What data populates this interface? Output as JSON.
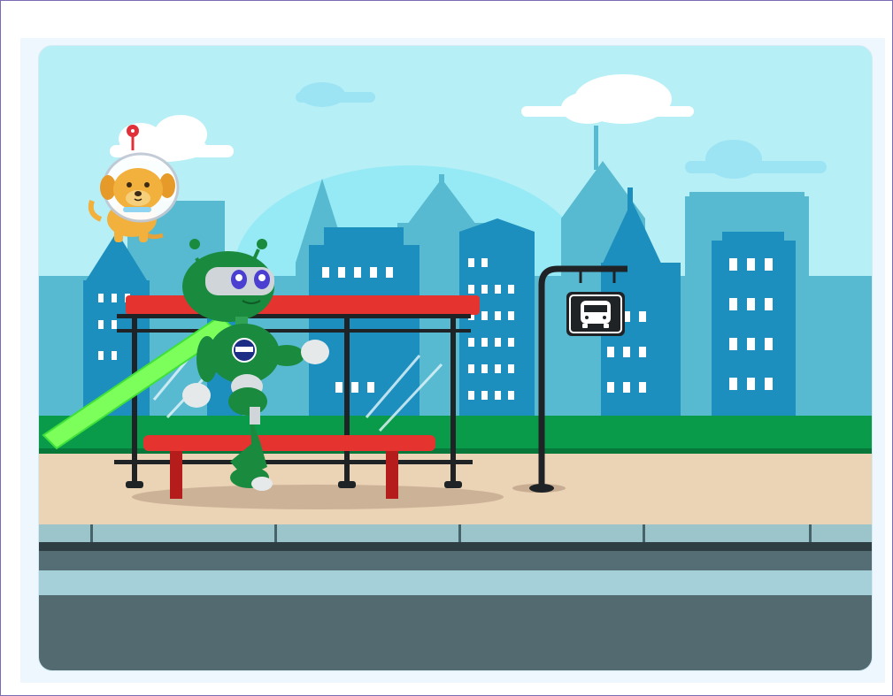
{
  "stage": {
    "scene": "city-bus-stop",
    "colors": {
      "sky": "#B7EFF6",
      "buildings_back": "#55B9CE",
      "buildings_front": "#1D8FBF",
      "grass": "#0A9B4A",
      "sidewalk": "#EBD3B6",
      "road": "#526A70",
      "shelter_roof": "#E53430",
      "robot": "#1A8A3E",
      "beam": "#7CFF5A"
    }
  },
  "sprites": [
    {
      "name": "space-dog",
      "icon": "dog-astronaut-icon"
    },
    {
      "name": "robot",
      "icon": "green-robot-icon"
    },
    {
      "name": "bus-stop-sign",
      "icon": "bus-icon"
    }
  ]
}
